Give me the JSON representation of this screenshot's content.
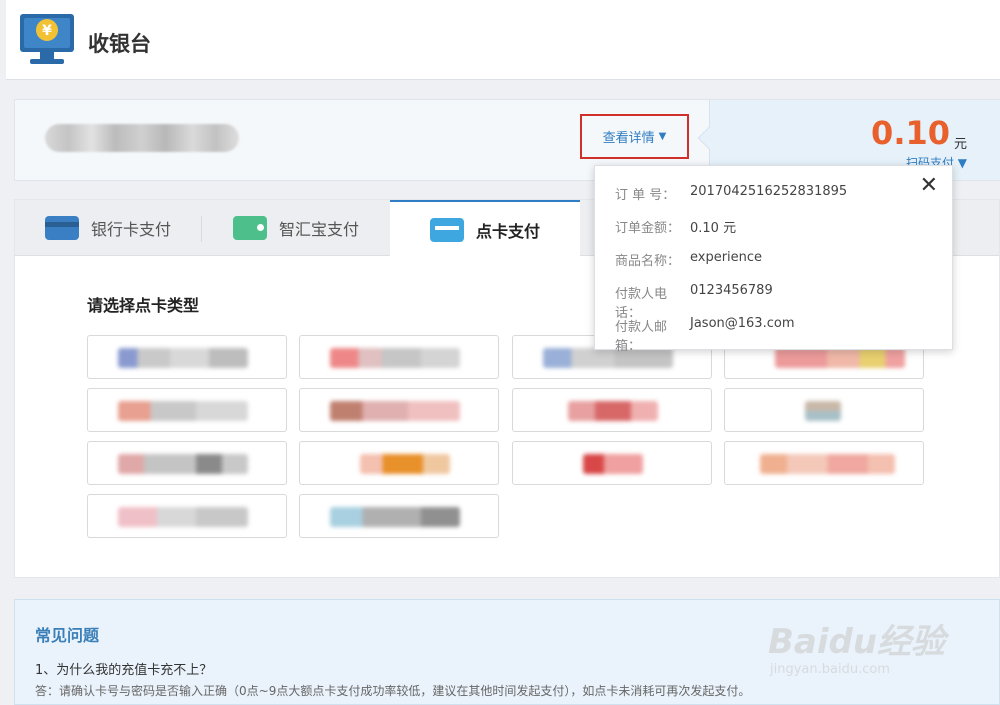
{
  "header": {
    "title": "收银台"
  },
  "order": {
    "detail_link": "查看详情",
    "amount": "0.10",
    "currency": "元",
    "pay_mode": "扫码支付 ▼"
  },
  "tabs": [
    {
      "label": "银行卡支付"
    },
    {
      "label": "智汇宝支付"
    },
    {
      "label": "点卡支付"
    }
  ],
  "section_title": "请选择点卡类型",
  "popup": {
    "rows": [
      {
        "label": "订 单 号：",
        "value": "2017042516252831895"
      },
      {
        "label": "订单金额：",
        "value": "0.10 元"
      },
      {
        "label": "商品名称：",
        "value": "experience"
      },
      {
        "label": "付款人电话：",
        "value": "0123456789"
      },
      {
        "label": "付款人邮箱：",
        "value": "Jason@163.com"
      }
    ]
  },
  "faq": {
    "title": "常见问题",
    "question": "1、为什么我的充值卡充不上？",
    "answer": "答：请确认卡号与密码是否输入正确（0点~9点大额点卡支付成功率较低，建议在其他时间发起支付），如点卡未消耗可再次发起支付。"
  },
  "watermark": {
    "main": "Baidu经验",
    "sub": "jingyan.baidu.com"
  },
  "colors": {
    "accent_blue": "#2f7dc2",
    "amount_orange": "#e8602c",
    "highlight_red": "#d0302a"
  }
}
